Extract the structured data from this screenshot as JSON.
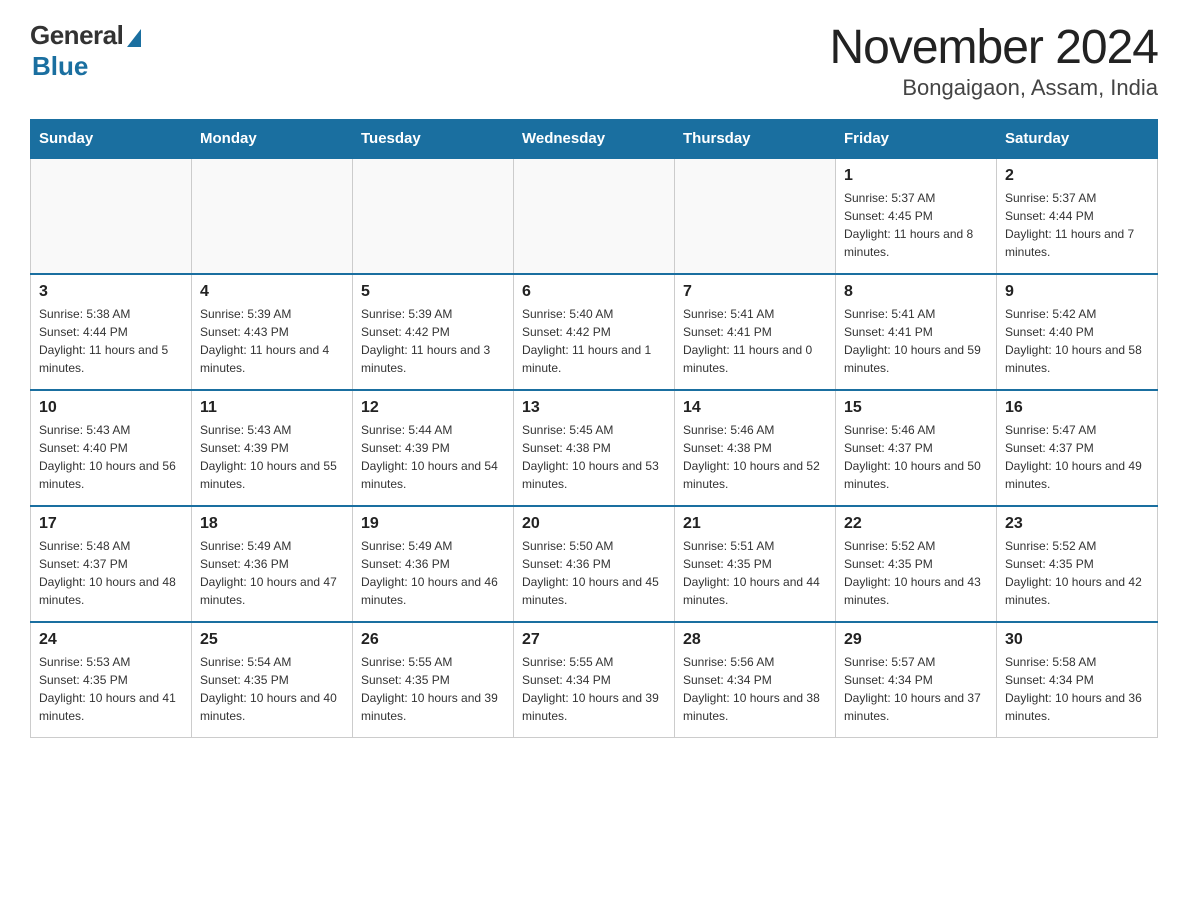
{
  "logo": {
    "general": "General",
    "blue": "Blue"
  },
  "title": "November 2024",
  "subtitle": "Bongaigaon, Assam, India",
  "days": [
    "Sunday",
    "Monday",
    "Tuesday",
    "Wednesday",
    "Thursday",
    "Friday",
    "Saturday"
  ],
  "weeks": [
    [
      {
        "day": "",
        "info": ""
      },
      {
        "day": "",
        "info": ""
      },
      {
        "day": "",
        "info": ""
      },
      {
        "day": "",
        "info": ""
      },
      {
        "day": "",
        "info": ""
      },
      {
        "day": "1",
        "info": "Sunrise: 5:37 AM\nSunset: 4:45 PM\nDaylight: 11 hours and 8 minutes."
      },
      {
        "day": "2",
        "info": "Sunrise: 5:37 AM\nSunset: 4:44 PM\nDaylight: 11 hours and 7 minutes."
      }
    ],
    [
      {
        "day": "3",
        "info": "Sunrise: 5:38 AM\nSunset: 4:44 PM\nDaylight: 11 hours and 5 minutes."
      },
      {
        "day": "4",
        "info": "Sunrise: 5:39 AM\nSunset: 4:43 PM\nDaylight: 11 hours and 4 minutes."
      },
      {
        "day": "5",
        "info": "Sunrise: 5:39 AM\nSunset: 4:42 PM\nDaylight: 11 hours and 3 minutes."
      },
      {
        "day": "6",
        "info": "Sunrise: 5:40 AM\nSunset: 4:42 PM\nDaylight: 11 hours and 1 minute."
      },
      {
        "day": "7",
        "info": "Sunrise: 5:41 AM\nSunset: 4:41 PM\nDaylight: 11 hours and 0 minutes."
      },
      {
        "day": "8",
        "info": "Sunrise: 5:41 AM\nSunset: 4:41 PM\nDaylight: 10 hours and 59 minutes."
      },
      {
        "day": "9",
        "info": "Sunrise: 5:42 AM\nSunset: 4:40 PM\nDaylight: 10 hours and 58 minutes."
      }
    ],
    [
      {
        "day": "10",
        "info": "Sunrise: 5:43 AM\nSunset: 4:40 PM\nDaylight: 10 hours and 56 minutes."
      },
      {
        "day": "11",
        "info": "Sunrise: 5:43 AM\nSunset: 4:39 PM\nDaylight: 10 hours and 55 minutes."
      },
      {
        "day": "12",
        "info": "Sunrise: 5:44 AM\nSunset: 4:39 PM\nDaylight: 10 hours and 54 minutes."
      },
      {
        "day": "13",
        "info": "Sunrise: 5:45 AM\nSunset: 4:38 PM\nDaylight: 10 hours and 53 minutes."
      },
      {
        "day": "14",
        "info": "Sunrise: 5:46 AM\nSunset: 4:38 PM\nDaylight: 10 hours and 52 minutes."
      },
      {
        "day": "15",
        "info": "Sunrise: 5:46 AM\nSunset: 4:37 PM\nDaylight: 10 hours and 50 minutes."
      },
      {
        "day": "16",
        "info": "Sunrise: 5:47 AM\nSunset: 4:37 PM\nDaylight: 10 hours and 49 minutes."
      }
    ],
    [
      {
        "day": "17",
        "info": "Sunrise: 5:48 AM\nSunset: 4:37 PM\nDaylight: 10 hours and 48 minutes."
      },
      {
        "day": "18",
        "info": "Sunrise: 5:49 AM\nSunset: 4:36 PM\nDaylight: 10 hours and 47 minutes."
      },
      {
        "day": "19",
        "info": "Sunrise: 5:49 AM\nSunset: 4:36 PM\nDaylight: 10 hours and 46 minutes."
      },
      {
        "day": "20",
        "info": "Sunrise: 5:50 AM\nSunset: 4:36 PM\nDaylight: 10 hours and 45 minutes."
      },
      {
        "day": "21",
        "info": "Sunrise: 5:51 AM\nSunset: 4:35 PM\nDaylight: 10 hours and 44 minutes."
      },
      {
        "day": "22",
        "info": "Sunrise: 5:52 AM\nSunset: 4:35 PM\nDaylight: 10 hours and 43 minutes."
      },
      {
        "day": "23",
        "info": "Sunrise: 5:52 AM\nSunset: 4:35 PM\nDaylight: 10 hours and 42 minutes."
      }
    ],
    [
      {
        "day": "24",
        "info": "Sunrise: 5:53 AM\nSunset: 4:35 PM\nDaylight: 10 hours and 41 minutes."
      },
      {
        "day": "25",
        "info": "Sunrise: 5:54 AM\nSunset: 4:35 PM\nDaylight: 10 hours and 40 minutes."
      },
      {
        "day": "26",
        "info": "Sunrise: 5:55 AM\nSunset: 4:35 PM\nDaylight: 10 hours and 39 minutes."
      },
      {
        "day": "27",
        "info": "Sunrise: 5:55 AM\nSunset: 4:34 PM\nDaylight: 10 hours and 39 minutes."
      },
      {
        "day": "28",
        "info": "Sunrise: 5:56 AM\nSunset: 4:34 PM\nDaylight: 10 hours and 38 minutes."
      },
      {
        "day": "29",
        "info": "Sunrise: 5:57 AM\nSunset: 4:34 PM\nDaylight: 10 hours and 37 minutes."
      },
      {
        "day": "30",
        "info": "Sunrise: 5:58 AM\nSunset: 4:34 PM\nDaylight: 10 hours and 36 minutes."
      }
    ]
  ]
}
